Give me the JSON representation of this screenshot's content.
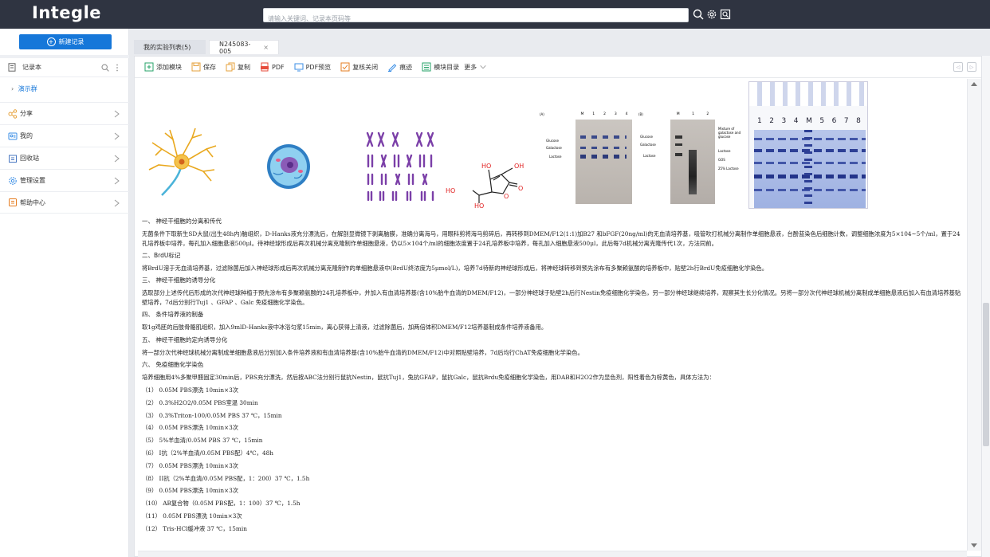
{
  "app": {
    "logo": "Integle"
  },
  "search": {
    "placeholder": "请输入关键词、记录本页码等"
  },
  "topbar": {
    "icons": [
      "search-icon",
      "settings-icon",
      "scan-icon"
    ]
  },
  "sidebar": {
    "new_record": "新建记录",
    "notebook": "记录本",
    "group": "演示群",
    "items": [
      {
        "label": "分享",
        "icon": "share-icon"
      },
      {
        "label": "我的",
        "icon": "mine-icon"
      },
      {
        "label": "回收站",
        "icon": "recycle-bin-icon"
      },
      {
        "label": "管理设置",
        "icon": "settings-icon"
      },
      {
        "label": "帮助中心",
        "icon": "help-icon"
      }
    ]
  },
  "tabs": [
    {
      "label": "我的实验列表(5)",
      "active": false
    },
    {
      "label": "N245083-005",
      "active": true,
      "close": "×"
    }
  ],
  "toolbar": {
    "items": [
      {
        "label": "添加模块",
        "icon": "add-module-icon"
      },
      {
        "label": "保存",
        "icon": "save-icon"
      },
      {
        "label": "复制",
        "icon": "copy-icon"
      },
      {
        "label": "PDF",
        "icon": "pdf-icon"
      },
      {
        "label": "PDF预览",
        "icon": "pdf-preview-icon"
      },
      {
        "label": "复核关闭",
        "icon": "review-close-icon"
      },
      {
        "label": "痕迹",
        "icon": "trace-icon"
      },
      {
        "label": "模块目录",
        "icon": "module-catalog-icon"
      }
    ],
    "more": "更多"
  },
  "figures": {
    "lactose_labels": [
      "Glucose",
      "Galactose",
      "Lactose"
    ],
    "gel_b_labels": [
      "Glucose",
      "Galactose",
      "Lactose",
      "Mixture of galactose and glucose",
      "Lactose",
      "GOS",
      "25% Lactose"
    ],
    "lanes_a": [
      "M",
      "1",
      "2",
      "3",
      "4"
    ],
    "lanes_b": [
      "M",
      "1",
      "2"
    ],
    "panel_a": "(A)",
    "panel_b": "(B)",
    "sds_lanes": [
      "1",
      "2",
      "3",
      "4",
      "M",
      "5",
      "6",
      "7",
      "8"
    ],
    "molecule_labels": [
      "HO",
      "OH",
      "HO",
      "HO",
      "O",
      "O"
    ]
  },
  "document": {
    "s1_title": "一、 神经干细胞的分离和传代",
    "s1_body": "无菌条件下取新生SD大鼠(出生48h内)脑组织，D-Hanks液充分漂洗后，在解剖显微镜下剥离脑膜，准确分离海马，用眼科剪将海马剪碎后，再转移到DMEM/F12(1:1)加B27 和bFGF(20ng/ml)的无血清培养基，吸管吹打机械分离制作单细胞悬液，台酚蓝染色后细胞计数，调整细胞浓度为5×104~5个/ml，置于24孔培养板中培养，每孔加入细胞悬液500μl。待神经球形成后再次机械分离克隆制作单细胞悬液，仍以5×104个/ml的细胞浓度置于24孔培养板中培养，每孔加入细胞悬液500μl，此后每7d机械分离克隆传代1次，方法同前。",
    "s2_title": "二、BrdU标记",
    "s2_body": "将BrdU溶于无血清培养基，过滤除菌后加入神经球形成后再次机械分离克隆制作的单细胞悬液中(BrdU终浓度为5μmol/L)，培养7d待新的神经球形成后，将神经球转移到预先涂布有多聚赖氨酸的培养板中，贴壁2h行BrdU免疫细胞化学染色。",
    "s3_title": "三、 神经干细胞的诱导分化",
    "s3_body": "选取部分上述传代后形成的次代神经球种植于预先涂布有多聚赖氨酸的24孔培养板中，并加入有血清培养基(含10%胎牛血清的DMEM/F12)，一部分神经球于贴壁2h后行Nestin免疫细胞化学染色，另一部分神经球继续培养，观察其生长分化情况。另将一部分次代神经球机械分离制成单细胞悬液后加入有血清培养基贴壁培养，7d后分别行Tuj1 、GFAP 、Galc 免疫细胞化学染色。",
    "s4_title": "四、 条件培养液的制备",
    "s4_body": "取1g鸡胚的后肢骨骼肌组织，加入9mlD-Hanks液中冰浴匀浆15min，离心获得上清液，过滤除菌后，加两倍体积DMEM/F12培养基制成条件培养液备用。",
    "s5_title": "五、 神经干细胞的定向诱导分化",
    "s5_body": "将一部分次代神经球机械分离制成单细胞悬液后分别加入条件培养液和有血清培养基(含10%胎牛血清的DMEM/F12)中对照贴壁培养，7d后均行ChAT免疫细胞化学染色。",
    "s6_title": "六、 免疫细胞化学染色",
    "s6_body": "培养细胞用4%多聚甲醛固定30min后，PBS充分漂洗，然后按ABC法分别行鼠抗Nestin，鼠抗Tuj1，兔抗GFAP，鼠抗Galc，鼠抗Brdu免疫细胞化学染色，用DAB和H2O2作为显色剂，阳性着色为棕黄色，具体方法为：",
    "steps": [
      "（1） 0.05M PBS漂洗 10min×3次",
      "（2） 0.3%H2O2/0.05M PBS室温 30min",
      "（3） 0.3%Triton-100/0.05M PBS 37 ℃，15min",
      "（4） 0.05M PBS漂洗 10min×3次",
      "（5） 5%羊血清/0.05M PBS 37 ℃，15min",
      "（6） I抗（2%羊血清/0.05M PBS配）4℃，48h",
      "（7） 0.05M PBS漂洗 10min×3次",
      "（8） II抗（2%羊血清/0.05M PBS配，1：200）37 ℃，1.5h",
      "（9） 0.05M PBS漂洗 10min×3次",
      "（10） AB复合物（0.05M PBS配，1：100）37 ℃，1.5h",
      "（11） 0.05M PBS漂洗 10min×3次",
      "（12） Tris-HCl缓冲液 37 ℃，15min"
    ]
  }
}
